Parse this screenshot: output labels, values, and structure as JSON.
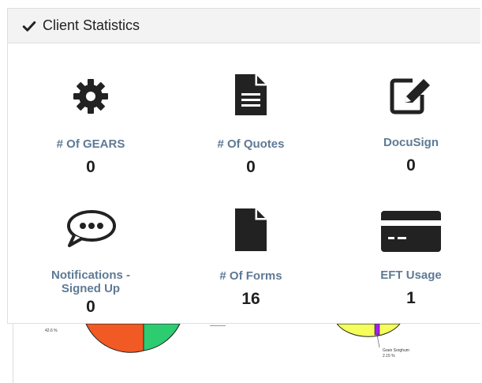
{
  "panel": {
    "title": "Client Statistics"
  },
  "stats": [
    {
      "icon": "gear-icon",
      "label": "# Of GEARS",
      "value": "0"
    },
    {
      "icon": "document-icon",
      "label": "# Of Quotes",
      "value": "0"
    },
    {
      "icon": "edit-icon",
      "label": "DocuSign",
      "value": "0"
    },
    {
      "icon": "chat-icon",
      "label_line1": "Notifications -",
      "label_line2": "Signed Up",
      "value": "0"
    },
    {
      "icon": "blank-file-icon",
      "label": "# Of Forms",
      "value": "16"
    },
    {
      "icon": "credit-card-icon",
      "label": "EFT Usage",
      "value": "1"
    }
  ],
  "charts": {
    "left_pct": "42.6 %",
    "right_label": "Grain Sorghum",
    "right_pct": "2.15 %"
  },
  "colors": {
    "label": "#5e7a95",
    "value": "#1f1f1f",
    "icon": "#222222",
    "orange": "#f15a24",
    "green": "#2ecc71",
    "yellow": "#f4ff5b",
    "purple": "#a020f0"
  }
}
